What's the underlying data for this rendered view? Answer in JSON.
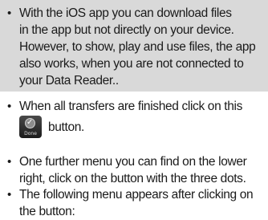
{
  "note": {
    "lines": [
      "With the iOS app you can download files",
      "in the app but not directly on your device.",
      "However, to show, play and use files, the app",
      "also works, when you are not connected to",
      "your Data Reader.."
    ]
  },
  "bullets": {
    "done": {
      "line1": "When all transfers are finished click on this",
      "line2": "button.",
      "icon": "done-button-icon",
      "icon_label": "Done"
    },
    "menu": {
      "line1": "One further menu you can find on the lower",
      "line2": "right, click on the button with the three dots."
    },
    "appears": {
      "line1": "The following menu appears after clicking on",
      "line2": "the button:"
    }
  },
  "bullet_symbol": "•",
  "colors": {
    "note_background": "#d9d9d9",
    "text": "#1a1a1a"
  }
}
